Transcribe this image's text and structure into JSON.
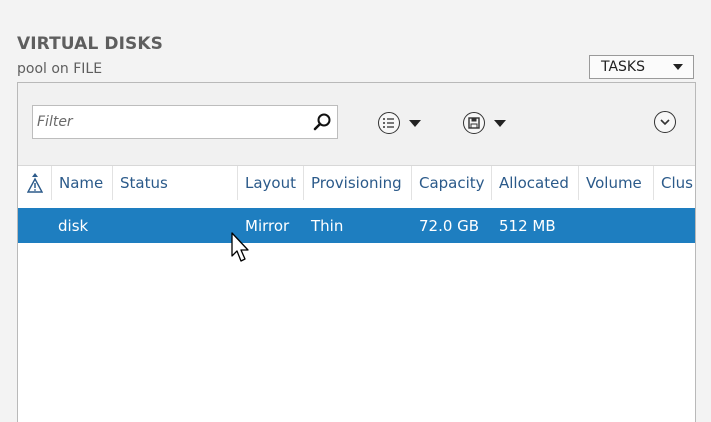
{
  "header": {
    "title": "VIRTUAL DISKS",
    "subtitle": "pool on FILE",
    "tasks_label": "TASKS"
  },
  "toolbar": {
    "filter_placeholder": "Filter",
    "icons": [
      "search-icon",
      "list-options-icon",
      "save-query-icon",
      "expand-icon"
    ]
  },
  "table": {
    "columns": [
      "Name",
      "Status",
      "Layout",
      "Provisioning",
      "Capacity",
      "Allocated",
      "Volume",
      "Clus"
    ],
    "rows": [
      {
        "name": "disk",
        "status": "",
        "layout": "Mirror",
        "provisioning": "Thin",
        "capacity": "72.0 GB",
        "allocated": "512 MB",
        "volume": "",
        "cluster": ""
      }
    ],
    "selected_row_index": 0
  },
  "colors": {
    "selection": "#1e7ec0",
    "header_text": "#2b5a8a",
    "title_text": "#5e5e5e"
  }
}
